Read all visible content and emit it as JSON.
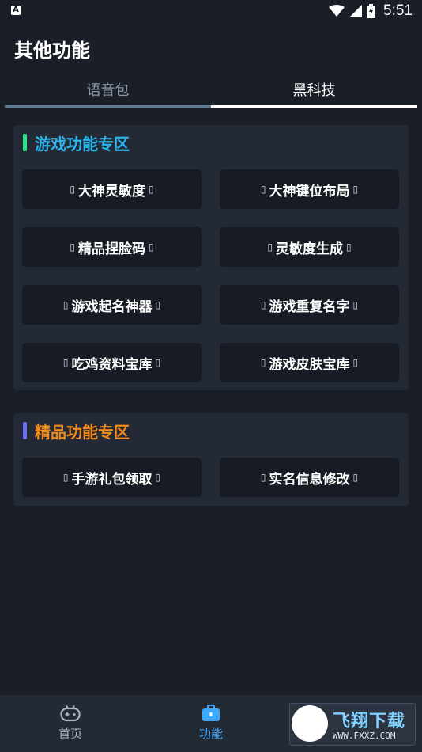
{
  "status_bar": {
    "time": "5:51"
  },
  "header": {
    "title": "其他功能"
  },
  "tabs": [
    {
      "label": "语音包"
    },
    {
      "label": "黑科技"
    }
  ],
  "sections": {
    "game": {
      "title": "游戏功能专区",
      "accent_color": "#2ee38c",
      "title_color": "#2ab5ec",
      "buttons": [
        {
          "label": "大神灵敏度"
        },
        {
          "label": "大神键位布局"
        },
        {
          "label": "精品捏脸码"
        },
        {
          "label": "灵敏度生成"
        },
        {
          "label": "游戏起名神器"
        },
        {
          "label": "游戏重复名字"
        },
        {
          "label": "吃鸡资料宝库"
        },
        {
          "label": "游戏皮肤宝库"
        }
      ]
    },
    "premium": {
      "title": "精品功能专区",
      "accent_color": "#6b6ff2",
      "title_color": "#f08a1c",
      "buttons": [
        {
          "label": "手游礼包领取"
        },
        {
          "label": "实名信息修改"
        }
      ]
    }
  },
  "bottom_nav": {
    "items": [
      {
        "label": "首页",
        "icon": "gamepad-icon"
      },
      {
        "label": "功能",
        "icon": "briefcase-icon"
      }
    ],
    "active_color": "#3ea8ff"
  },
  "watermark": {
    "brand": "飞翔下载",
    "url": "WWW.FXXZ.COM"
  },
  "button_bracket_glyph": "▯"
}
